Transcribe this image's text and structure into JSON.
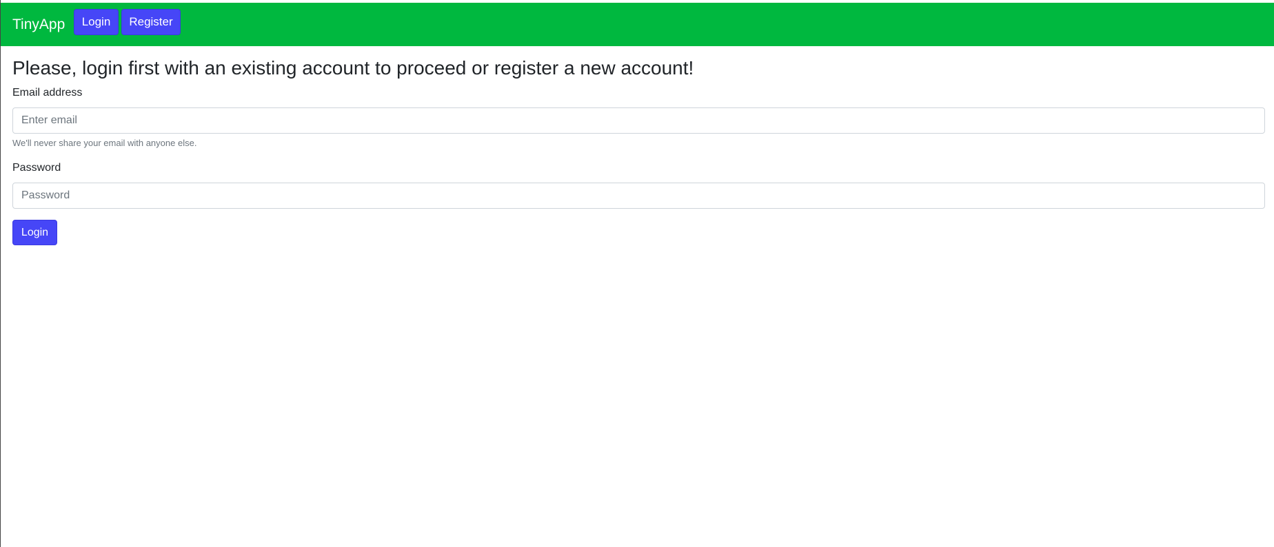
{
  "navbar": {
    "brand": "TinyApp",
    "login_label": "Login",
    "register_label": "Register",
    "color": "#00b83f",
    "button_color": "#4646f7"
  },
  "main": {
    "title": "Please, login first with an existing account to proceed or register a new account!",
    "email_label": "Email address",
    "email_placeholder": "Enter email",
    "email_help": "We'll never share your email with anyone else.",
    "password_label": "Password",
    "password_placeholder": "Password",
    "submit_label": "Login"
  }
}
